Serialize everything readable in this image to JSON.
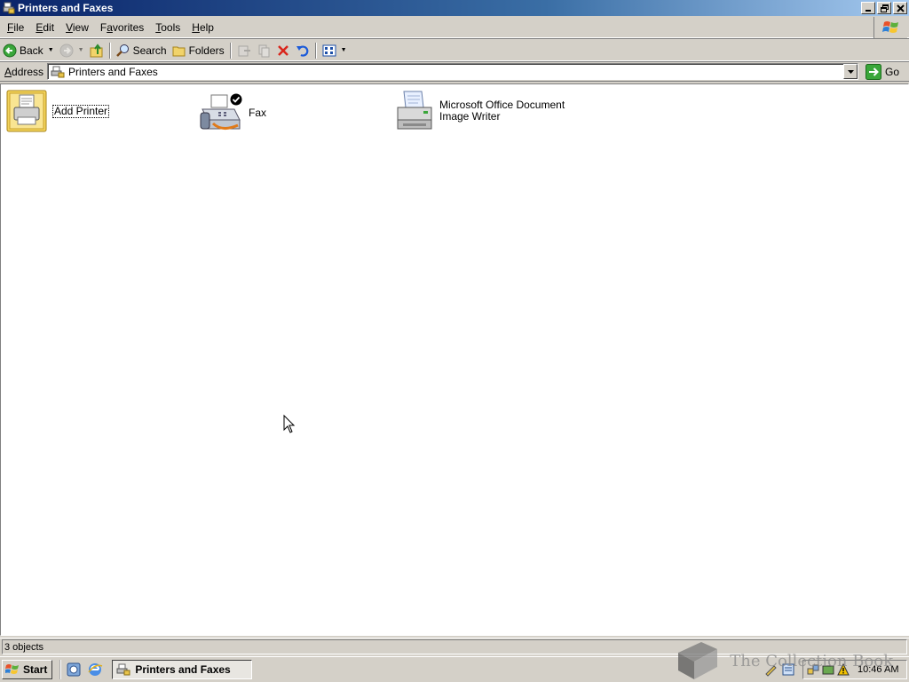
{
  "window": {
    "title": "Printers and Faxes"
  },
  "menu": {
    "items": [
      {
        "label": "File",
        "accel": "F",
        "rest": "ile"
      },
      {
        "label": "Edit",
        "accel": "E",
        "rest": "dit"
      },
      {
        "label": "View",
        "accel": "V",
        "rest": "iew"
      },
      {
        "label": "Favorites",
        "accel": "a",
        "pre": "F",
        "rest": "vorites"
      },
      {
        "label": "Tools",
        "accel": "T",
        "rest": "ools"
      },
      {
        "label": "Help",
        "accel": "H",
        "rest": "elp"
      }
    ]
  },
  "toolbar": {
    "back_label": "Back",
    "search_label": "Search",
    "folders_label": "Folders"
  },
  "address": {
    "label_accel": "A",
    "label_rest": "ddress",
    "value": "Printers and Faxes",
    "go_label": "Go"
  },
  "content": {
    "items": [
      {
        "label": "Add Printer",
        "icon": "add-printer-icon"
      },
      {
        "label": "Fax",
        "icon": "fax-icon",
        "default": true
      },
      {
        "label_line1": "Microsoft Office Document",
        "label_line2": "Image Writer",
        "icon": "printer-icon"
      }
    ]
  },
  "status": {
    "text": "3 objects"
  },
  "taskbar": {
    "start_label": "Start",
    "task_label": "Printers and Faxes",
    "clock": "10:46 AM"
  },
  "watermark": {
    "text": "The Collection Book"
  },
  "colors": {
    "title_gradient_start": "#0a246a",
    "title_gradient_end": "#a6caf0",
    "chrome": "#d4d0c8"
  }
}
